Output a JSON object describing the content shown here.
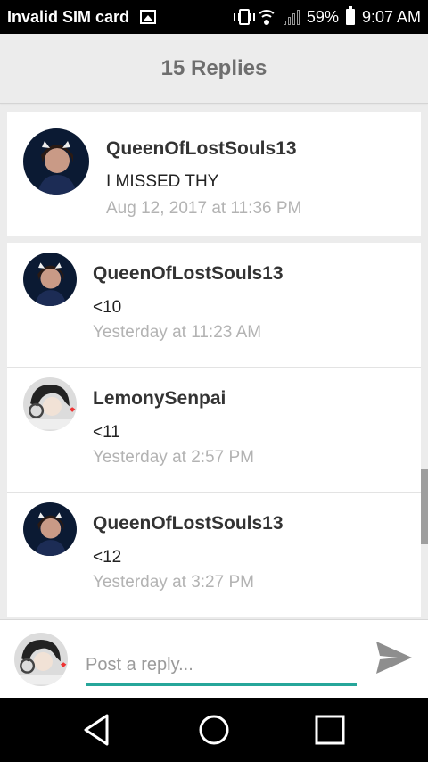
{
  "status_bar": {
    "carrier": "Invalid SIM card",
    "battery": "59%",
    "time": "9:07 AM",
    "icons": [
      "image-icon",
      "vibrate-icon",
      "wifi-icon",
      "signal-icon",
      "battery-icon"
    ]
  },
  "header": {
    "title": "15 Replies"
  },
  "parent_comment": {
    "author": "QueenOfLostSouls13",
    "text": "I MISSED THY",
    "time": "Aug 12, 2017 at 11:36 PM"
  },
  "replies": [
    {
      "author": "QueenOfLostSouls13",
      "text": "<10",
      "time": "Yesterday at 11:23 AM"
    },
    {
      "author": "LemonySenpai",
      "text": "<11",
      "time": "Yesterday at 2:57 PM"
    },
    {
      "author": "QueenOfLostSouls13",
      "text": "<12",
      "time": "Yesterday at 3:27 PM"
    }
  ],
  "reply_bar": {
    "placeholder": "Post a reply..."
  },
  "colors": {
    "accent": "#26a69a",
    "muted_text": "#b3b3b3",
    "header_text": "#6e6e6e"
  }
}
